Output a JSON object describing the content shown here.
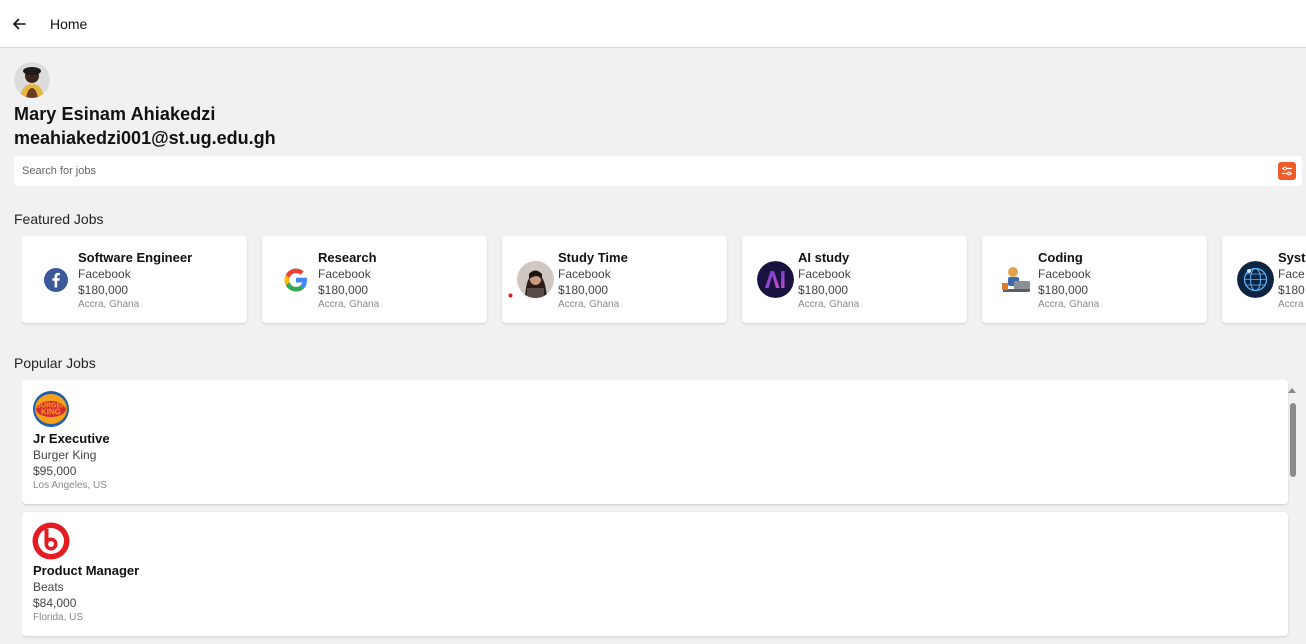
{
  "appbar": {
    "title": "Home"
  },
  "user": {
    "name": "Mary Esinam Ahiakedzi",
    "email": "meahiakedzi001@st.ug.edu.gh"
  },
  "search": {
    "placeholder": "Search for jobs"
  },
  "sections": {
    "featured": "Featured Jobs",
    "popular": "Popular Jobs"
  },
  "featured_jobs": [
    {
      "title": "Software Engineer",
      "company": "Facebook",
      "salary": "$180,000",
      "location": "Accra, Ghana",
      "icon": "facebook-logo-icon"
    },
    {
      "title": "Research",
      "company": "Facebook",
      "salary": "$180,000",
      "location": "Accra, Ghana",
      "icon": "google-logo-icon"
    },
    {
      "title": "Study Time",
      "company": "Facebook",
      "salary": "$180,000",
      "location": "Accra, Ghana",
      "icon": "study-photo-icon"
    },
    {
      "title": "AI study",
      "company": "Facebook",
      "salary": "$180,000",
      "location": "Accra, Ghana",
      "icon": "ai-logo-icon"
    },
    {
      "title": "Coding",
      "company": "Facebook",
      "salary": "$180,000",
      "location": "Accra, Ghana",
      "icon": "coding-illustration-icon"
    },
    {
      "title": "Syst",
      "company": "Face",
      "salary": "$180",
      "location": "Accra",
      "icon": "system-globe-icon"
    }
  ],
  "popular_jobs": [
    {
      "title": "Jr Executive",
      "company": "Burger King",
      "salary": "$95,000",
      "location": "Los Angeles, US",
      "icon": "burger-king-logo-icon"
    },
    {
      "title": "Product Manager",
      "company": "Beats",
      "salary": "$84,000",
      "location": "Florida, US",
      "icon": "beats-logo-icon"
    }
  ],
  "colors": {
    "accent": "#f15a2b",
    "facebook": "#3b5998",
    "beats": "#e31b23"
  }
}
